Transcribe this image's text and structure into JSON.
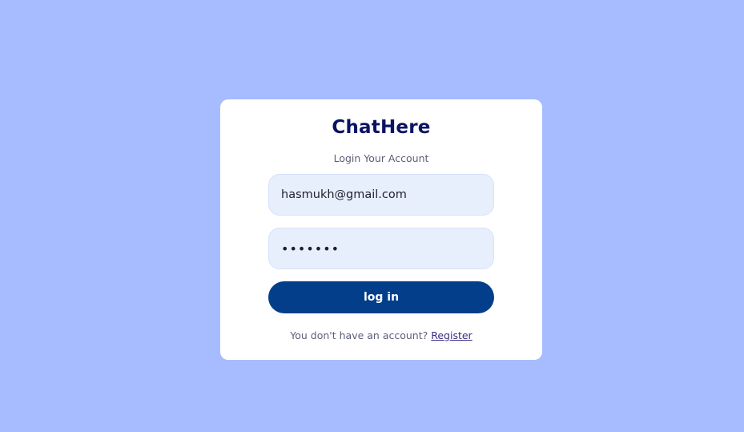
{
  "app": {
    "title": "ChatHere",
    "subtitle": "Login Your Account"
  },
  "form": {
    "email_value": "hasmukh@gmail.com",
    "password_value": "1234567",
    "login_label": "log in"
  },
  "footer": {
    "prompt": "You don't have an account?",
    "register_label": "Register"
  },
  "colors": {
    "background": "#a7bcfe",
    "card": "#ffffff",
    "title": "#0b1463",
    "button": "#023e8a",
    "input_bg": "#e8effc"
  }
}
